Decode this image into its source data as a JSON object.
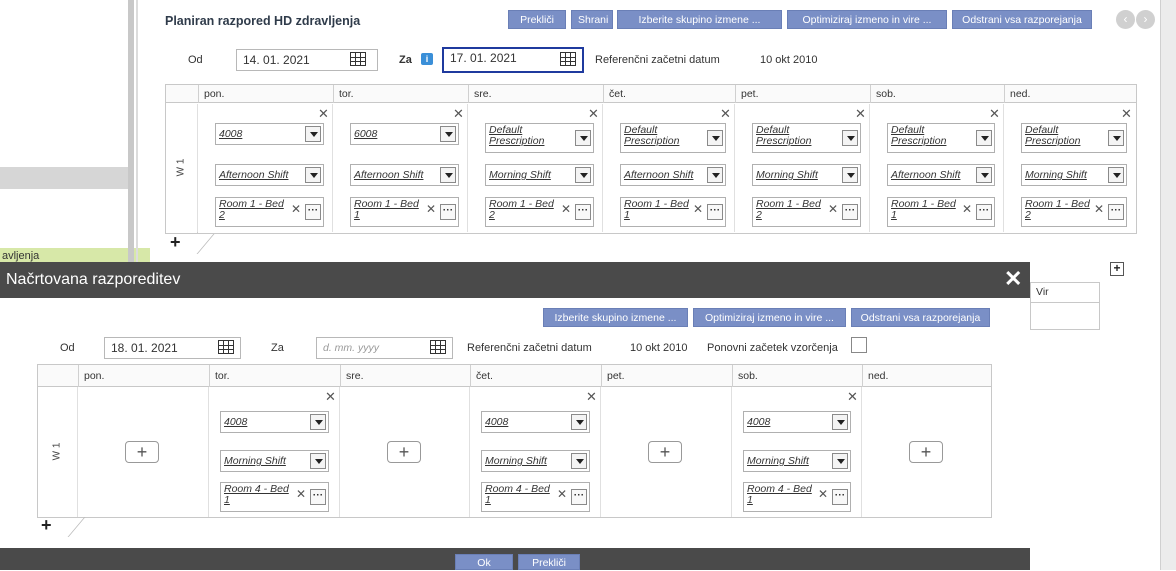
{
  "background": {
    "left_tab": "avljenja",
    "title": "Planiran razpored HD zdravljenja",
    "toolbar": {
      "cancel": "Prekliči",
      "save": "Shrani",
      "select_group": "Izberite skupino izmene ...",
      "optimize": "Optimiziraj izmeno in vire ...",
      "remove_all": "Odstrani vsa razporejanja"
    },
    "from_label": "Od",
    "from_value": "14. 01. 2021",
    "to_label": "Za",
    "to_value": "17. 01. 2021",
    "ref_label": "Referenčni začetni datum",
    "ref_value": "10 okt 2010",
    "days": [
      "pon.",
      "tor.",
      "sre.",
      "čet.",
      "pet.",
      "sob.",
      "ned."
    ],
    "week_label": "W 1",
    "cells": [
      {
        "prescription": "4008",
        "shift": "Afternoon Shift",
        "room": "Room 1 - Bed 2"
      },
      {
        "prescription": "6008",
        "shift": "Afternoon Shift",
        "room": "Room 1 - Bed 1"
      },
      {
        "prescription": "Default Prescription",
        "shift": "Morning Shift",
        "room": "Room 1 - Bed 2"
      },
      {
        "prescription": "Default Prescription",
        "shift": "Afternoon Shift",
        "room": "Room 1 - Bed 1"
      },
      {
        "prescription": "Default Prescription",
        "shift": "Morning Shift",
        "room": "Room 1 - Bed 2"
      },
      {
        "prescription": "Default Prescription",
        "shift": "Afternoon Shift",
        "room": "Room 1 - Bed 1"
      },
      {
        "prescription": "Default Prescription",
        "shift": "Morning Shift",
        "room": "Room 1 - Bed 2"
      }
    ],
    "add_symbol": "+",
    "vir_label": "Vir"
  },
  "modal": {
    "title": "Načrtovana razporeditev",
    "close": "✕",
    "toolbar": {
      "select_group": "Izberite skupino izmene ...",
      "optimize": "Optimiziraj izmeno in vire ...",
      "remove_all": "Odstrani vsa razporejanja"
    },
    "from_label": "Od",
    "from_value": "18. 01. 2021",
    "to_label": "Za",
    "to_placeholder": "d. mm. yyyy",
    "ref_label": "Referenčni začetni datum",
    "ref_value": "10 okt 2010",
    "restart_label": "Ponovni začetek vzorčenja",
    "days": [
      "pon.",
      "tor.",
      "sre.",
      "čet.",
      "pet.",
      "sob.",
      "ned."
    ],
    "week_label": "W 1",
    "filled": {
      "tor": {
        "prescription": "4008",
        "shift": "Morning Shift",
        "room": "Room 4 - Bed 1"
      },
      "cet": {
        "prescription": "4008",
        "shift": "Morning Shift",
        "room": "Room 4 - Bed 1"
      },
      "sob": {
        "prescription": "4008",
        "shift": "Morning Shift",
        "room": "Room 4 - Bed 1"
      }
    },
    "ok": "Ok",
    "cancel": "Prekliči",
    "add_symbol": "+"
  }
}
